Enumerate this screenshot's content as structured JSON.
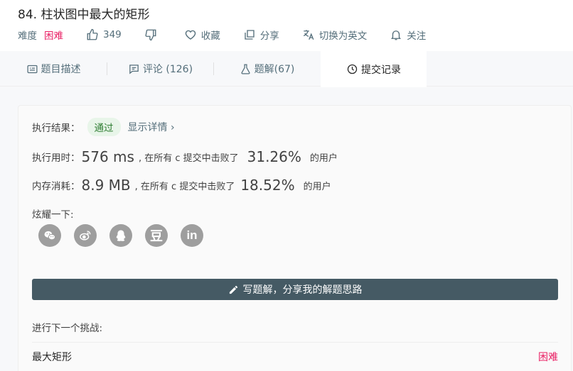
{
  "problem": {
    "title": "84. 柱状图中最大的矩形",
    "difficulty_label": "难度",
    "difficulty": "困难",
    "likes": "349",
    "favorite_label": "收藏",
    "share_label": "分享",
    "switch_lang_label": "切换为英文",
    "follow_label": "关注"
  },
  "tabs": [
    {
      "label": "题目描述",
      "icon": "description-icon"
    },
    {
      "label": "评论 (126)",
      "icon": "comment-icon"
    },
    {
      "label": "题解(67)",
      "icon": "flask-icon"
    },
    {
      "label": "提交记录",
      "icon": "clock-icon",
      "active": true
    }
  ],
  "result": {
    "status_label": "执行结果：",
    "status": "通过",
    "detail_link": "显示详情 ›",
    "runtime_label": "执行用时：",
    "runtime_value": "576 ms",
    "runtime_mid": ", 在所有 c 提交中击败了",
    "runtime_percent": "31.26%",
    "runtime_suffix": "的用户",
    "memory_label": "内存消耗：",
    "memory_value": "8.9 MB",
    "memory_mid": ", 在所有 c 提交中击败了",
    "memory_percent": "18.52%",
    "memory_suffix": "的用户"
  },
  "share": {
    "label": "炫耀一下:",
    "icons": [
      "wechat-icon",
      "weibo-icon",
      "qq-icon",
      "douban-icon",
      "linkedin-icon"
    ],
    "douban_glyph": "豆",
    "linkedin_glyph": "in"
  },
  "write_button": "写题解，分享我的解题思路",
  "next": {
    "label": "进行下一个挑战:",
    "title": "最大矩形",
    "difficulty": "困难"
  },
  "colors": {
    "accent_dark": "#455a64",
    "hard": "#e91e63",
    "pass_bg": "#e8f5e9",
    "pass_text": "#2e7d32"
  }
}
